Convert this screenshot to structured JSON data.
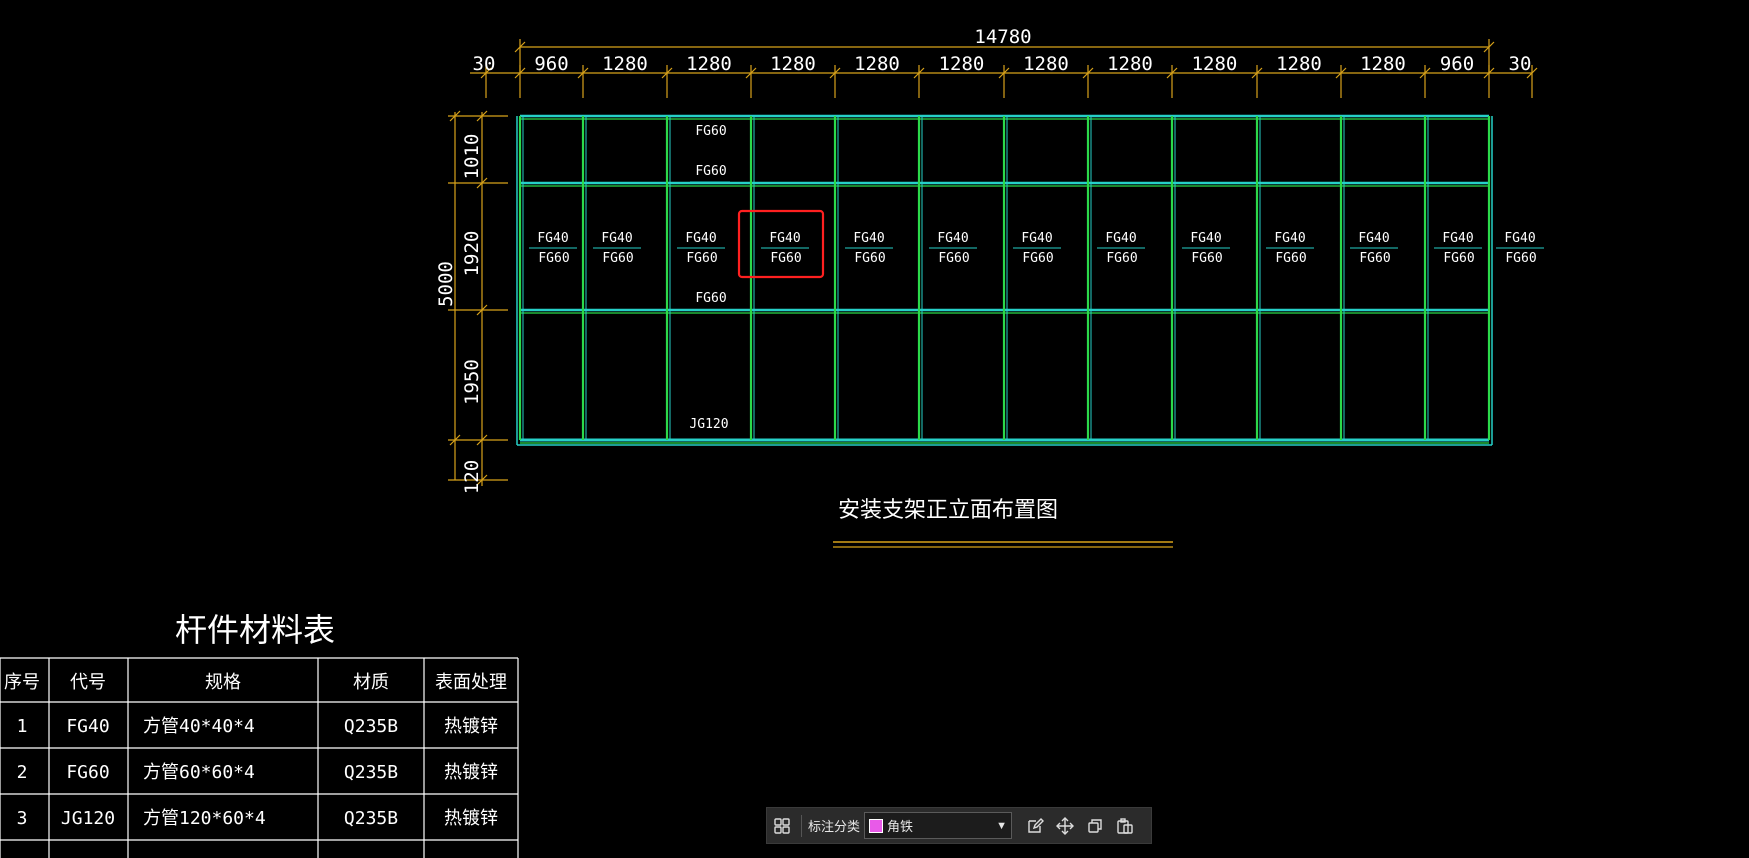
{
  "drawing": {
    "top_total": "14780",
    "top_dims": [
      "30",
      "960",
      "1280",
      "1280",
      "1280",
      "1280",
      "1280",
      "1280",
      "1280",
      "1280",
      "1280",
      "1280",
      "960",
      "30"
    ],
    "left_total": "5000",
    "left_dims": [
      "1010",
      "1920",
      "1950",
      "120"
    ],
    "top_row_labels": [
      "FG60",
      "FG60"
    ],
    "mid_upper_label": "FG40",
    "mid_lower_label": "FG60",
    "bottom_mid_label": "FG60",
    "bottom_label": "JG120",
    "title": "安装支架正立面布置图"
  },
  "material_table": {
    "title": "杆件材料表",
    "headers": [
      "序号",
      "代号",
      "规格",
      "材质",
      "表面处理"
    ],
    "rows": [
      [
        "1",
        "FG40",
        "方管40*40*4",
        "Q235B",
        "热镀锌"
      ],
      [
        "2",
        "FG60",
        "方管60*60*4",
        "Q235B",
        "热镀锌"
      ],
      [
        "3",
        "JG120",
        "方管120*60*4",
        "Q235B",
        "热镀锌"
      ]
    ]
  },
  "toolbar": {
    "grid_icon": "grid-icon",
    "label": "标注分类",
    "selected": "角铁",
    "swatch_color": "#e85ae8",
    "actions": [
      "edit-icon",
      "move-icon",
      "copy-icon",
      "paste-icon"
    ]
  },
  "colors": {
    "frame_green": "#2bd94a",
    "frame_cyan": "#26d0c8",
    "dim_yellow": "#d8a21a",
    "highlight_red": "#ff2020"
  }
}
